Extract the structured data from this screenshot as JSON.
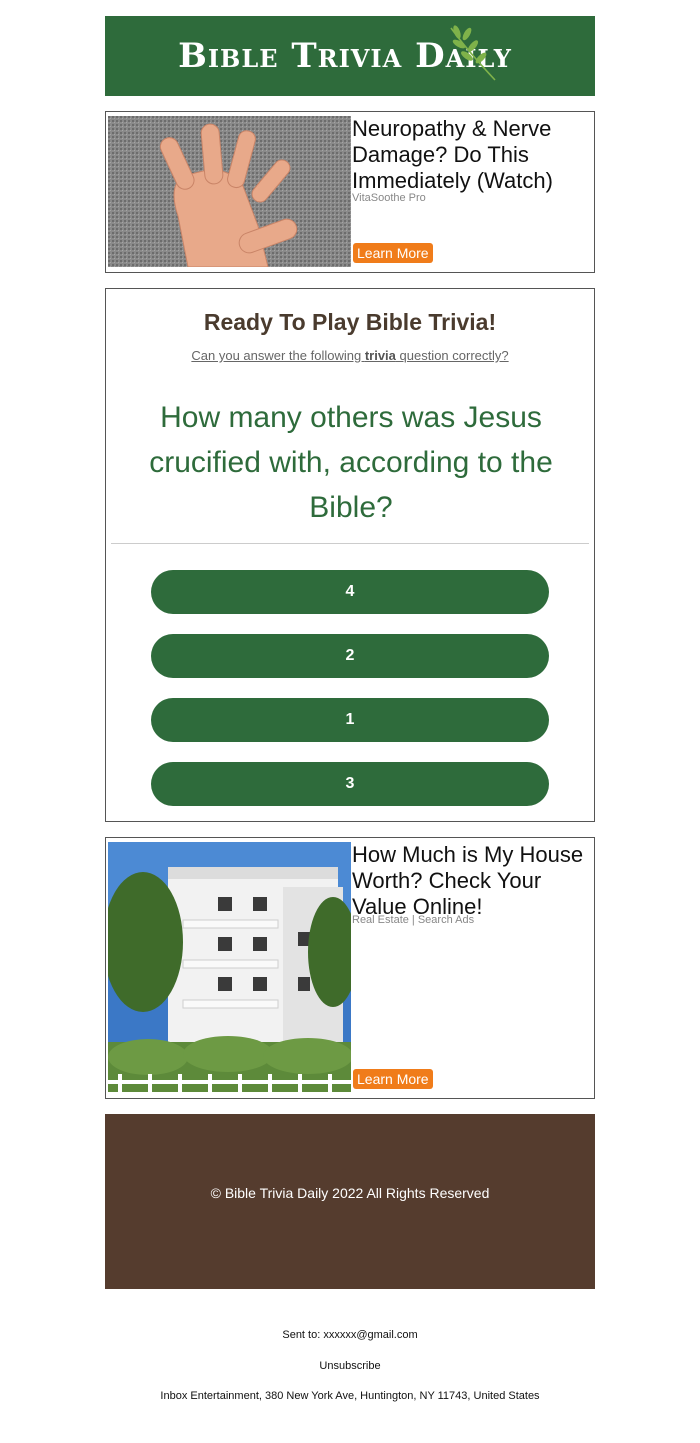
{
  "header": {
    "logo_text": "Bible Trivia Daily"
  },
  "ad1": {
    "title": "Neuropathy & Nerve Damage? Do This Immediately (Watch)",
    "source": "VitaSoothe Pro",
    "cta": "Learn More"
  },
  "trivia": {
    "title": "Ready To Play Bible Trivia!",
    "subtitle_pre": "Can you answer the following ",
    "subtitle_bold": "trivia",
    "subtitle_post": " question correctly?",
    "question": "How many others was Jesus crucified with, according to the Bible?",
    "answers": [
      "4",
      "2",
      "1",
      "3"
    ]
  },
  "ad2": {
    "title": "How Much is My House Worth? Check Your Value Online!",
    "source": "Real Estate | Search Ads",
    "cta": "Learn More"
  },
  "footer": {
    "copyright": "© Bible Trivia Daily 2022 All Rights Reserved"
  },
  "meta": {
    "sent_to": "Sent to: xxxxxx@gmail.com",
    "unsubscribe": "Unsubscribe",
    "address": "Inbox Entertainment, 380 New York Ave, Huntington, NY 11743, United States"
  },
  "colors": {
    "brand_green": "#2e6b3b",
    "footer_brown": "#553c2e",
    "cta_orange": "#f07c1a"
  }
}
